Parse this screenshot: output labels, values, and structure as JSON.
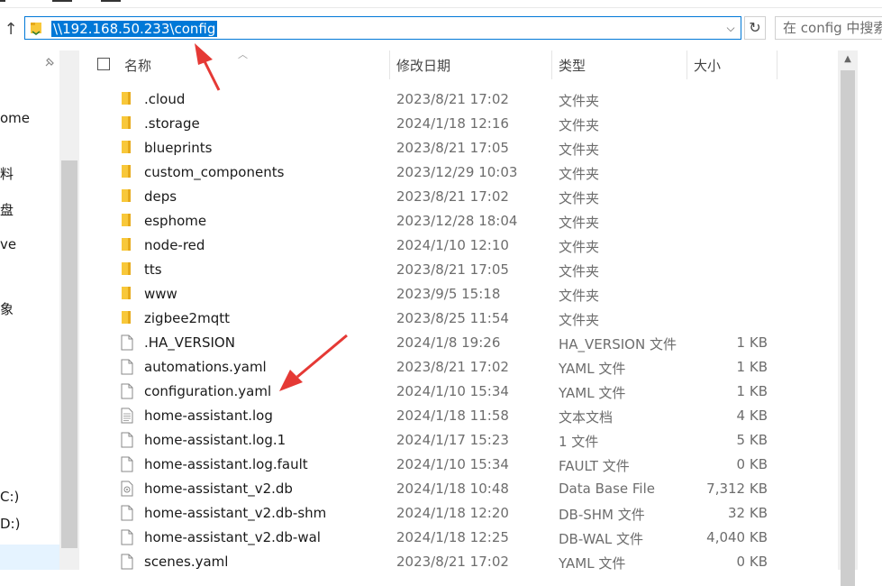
{
  "address": {
    "path": "\\\\192.168.50.233\\config",
    "search_placeholder": "在 config 中搜索"
  },
  "nav": {
    "items": [
      {
        "label": "ome"
      },
      {
        "label": "料"
      },
      {
        "label": "盘"
      },
      {
        "label": "ve"
      },
      {
        "label": "象"
      },
      {
        "label": "C:)"
      },
      {
        "label": "D:)"
      }
    ]
  },
  "columns": {
    "name": "名称",
    "date": "修改日期",
    "type": "类型",
    "size": "大小"
  },
  "files": [
    {
      "name": ".cloud",
      "date": "2023/8/21 17:02",
      "type": "文件夹",
      "size": "",
      "icon": "folder-icon"
    },
    {
      "name": ".storage",
      "date": "2024/1/18 12:16",
      "type": "文件夹",
      "size": "",
      "icon": "folder-icon"
    },
    {
      "name": "blueprints",
      "date": "2023/8/21 17:05",
      "type": "文件夹",
      "size": "",
      "icon": "folder-icon"
    },
    {
      "name": "custom_components",
      "date": "2023/12/29 10:03",
      "type": "文件夹",
      "size": "",
      "icon": "folder-icon"
    },
    {
      "name": "deps",
      "date": "2023/8/21 17:02",
      "type": "文件夹",
      "size": "",
      "icon": "folder-icon"
    },
    {
      "name": "esphome",
      "date": "2023/12/28 18:04",
      "type": "文件夹",
      "size": "",
      "icon": "folder-icon"
    },
    {
      "name": "node-red",
      "date": "2024/1/10 12:10",
      "type": "文件夹",
      "size": "",
      "icon": "folder-icon"
    },
    {
      "name": "tts",
      "date": "2023/8/21 17:05",
      "type": "文件夹",
      "size": "",
      "icon": "folder-icon"
    },
    {
      "name": "www",
      "date": "2023/9/5 15:18",
      "type": "文件夹",
      "size": "",
      "icon": "folder-icon"
    },
    {
      "name": "zigbee2mqtt",
      "date": "2023/8/25 11:54",
      "type": "文件夹",
      "size": "",
      "icon": "folder-icon"
    },
    {
      "name": ".HA_VERSION",
      "date": "2024/1/8 19:26",
      "type": "HA_VERSION 文件",
      "size": "1 KB",
      "icon": "file-icon"
    },
    {
      "name": "automations.yaml",
      "date": "2023/8/21 17:02",
      "type": "YAML 文件",
      "size": "1 KB",
      "icon": "file-icon"
    },
    {
      "name": "configuration.yaml",
      "date": "2024/1/10 15:34",
      "type": "YAML 文件",
      "size": "1 KB",
      "icon": "file-icon"
    },
    {
      "name": "home-assistant.log",
      "date": "2024/1/18 11:58",
      "type": "文本文档",
      "size": "4 KB",
      "icon": "text-file-icon"
    },
    {
      "name": "home-assistant.log.1",
      "date": "2024/1/17 15:23",
      "type": "1 文件",
      "size": "5 KB",
      "icon": "file-icon"
    },
    {
      "name": "home-assistant.log.fault",
      "date": "2024/1/10 15:34",
      "type": "FAULT 文件",
      "size": "0 KB",
      "icon": "file-icon"
    },
    {
      "name": "home-assistant_v2.db",
      "date": "2024/1/18 10:48",
      "type": "Data Base File",
      "size": "7,312 KB",
      "icon": "db-file-icon"
    },
    {
      "name": "home-assistant_v2.db-shm",
      "date": "2024/1/18 12:20",
      "type": "DB-SHM 文件",
      "size": "32 KB",
      "icon": "file-icon"
    },
    {
      "name": "home-assistant_v2.db-wal",
      "date": "2024/1/18 12:25",
      "type": "DB-WAL 文件",
      "size": "4,040 KB",
      "icon": "file-icon"
    },
    {
      "name": "scenes.yaml",
      "date": "2023/8/21 17:02",
      "type": "YAML 文件",
      "size": "0 KB",
      "icon": "file-icon"
    }
  ],
  "colors": {
    "accent": "#0078d7",
    "folder": "#f8c83a",
    "annotation_arrow": "#e53935"
  }
}
